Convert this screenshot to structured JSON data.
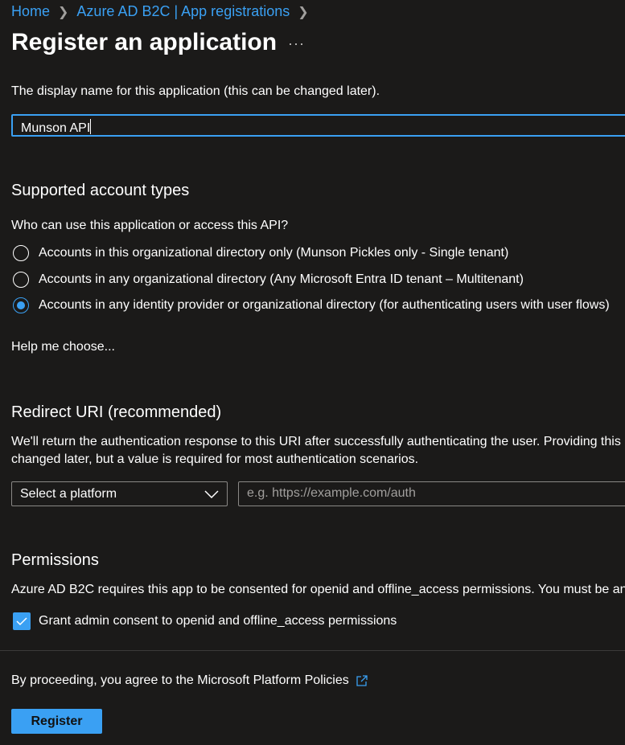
{
  "breadcrumb": {
    "items": [
      "Home",
      "Azure AD B2C | App registrations"
    ]
  },
  "page": {
    "title": "Register an application",
    "more_icon": "ellipsis-icon"
  },
  "name": {
    "label": "The display name for this application (this can be changed later).",
    "value": "Munson API"
  },
  "accounts": {
    "heading": "Supported account types",
    "question": "Who can use this application or access this API?",
    "options": [
      {
        "label": "Accounts in this organizational directory only (Munson Pickles only - Single tenant)",
        "selected": false
      },
      {
        "label": "Accounts in any organizational directory (Any Microsoft Entra ID tenant – Multitenant)",
        "selected": false
      },
      {
        "label": "Accounts in any identity provider or organizational directory (for authenticating users with user flows)",
        "selected": true
      }
    ],
    "help_link": "Help me choose..."
  },
  "redirect": {
    "heading": "Redirect URI (recommended)",
    "desc1": "We'll return the authentication response to this URI after successfully authenticating the user. Providing this",
    "desc2": "changed later, but a value is required for most authentication scenarios.",
    "platform": "Select a platform",
    "uri_placeholder": "e.g. https://example.com/auth"
  },
  "permissions": {
    "heading": "Permissions",
    "desc": "Azure AD B2C requires this app to be consented for openid and offline_access permissions. You must be an",
    "checkbox_label": "Grant admin consent to openid and offline_access permissions",
    "checked": true
  },
  "footer": {
    "policy_link": "By proceeding, you agree to the Microsoft Platform Policies",
    "register": "Register"
  },
  "colors": {
    "accent": "#3aa0f3",
    "background": "#1b1a19"
  }
}
